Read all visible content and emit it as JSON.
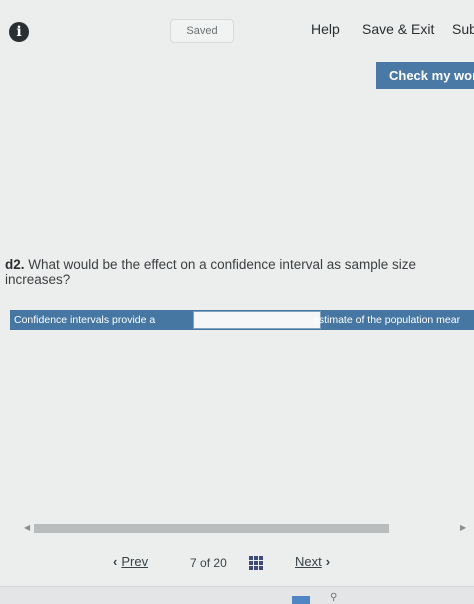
{
  "header": {
    "status": "Saved",
    "help": "Help",
    "save_exit": "Save & Exit",
    "submit": "Sub",
    "check_button": "Check my wor"
  },
  "question": {
    "number": "d2.",
    "text": " What would be the effect on a confidence interval as sample size increases?"
  },
  "answer": {
    "prefix": "Confidence intervals provide a",
    "selected": "",
    "suffix": "estimate of the population mear"
  },
  "navigation": {
    "prev": "Prev",
    "current": "7",
    "of": "of",
    "total": "20",
    "next": "Next"
  },
  "icons": {
    "info": "info-icon",
    "grid": "grid-icon",
    "prev": "chevron-left-icon",
    "next": "chevron-right-icon",
    "search": "search-icon"
  },
  "colors": {
    "accent": "#4a79a6",
    "answer_row": "#4677a3",
    "background": "#eceeee"
  }
}
